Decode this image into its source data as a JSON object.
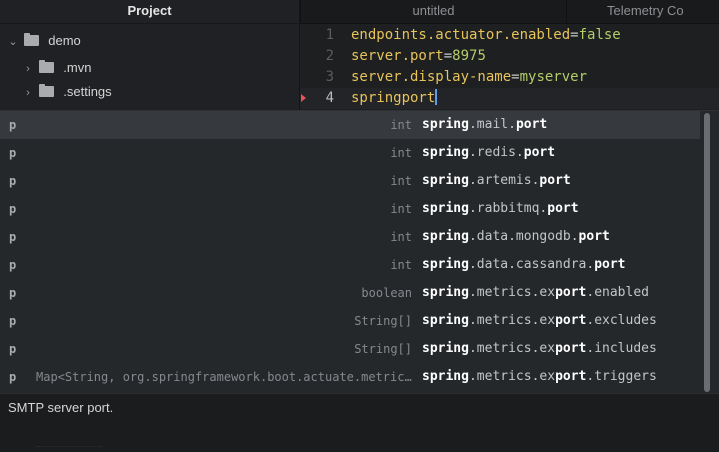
{
  "project": {
    "title": "Project",
    "tree": [
      {
        "label": "demo",
        "expanded": true
      },
      {
        "label": ".mvn",
        "expanded": false
      },
      {
        "label": ".settings",
        "expanded": false
      }
    ]
  },
  "tabs": [
    "untitled",
    "Telemetry Co"
  ],
  "editor": {
    "lines": [
      {
        "num": "1",
        "key": "endpoints.actuator.enabled",
        "eq": "=",
        "value": "false"
      },
      {
        "num": "2",
        "key": "server.port",
        "eq": "=",
        "value": "8975"
      },
      {
        "num": "3",
        "key": "server.display-name",
        "eq": "=",
        "value": "myserver"
      },
      {
        "num": "4",
        "key": "springport",
        "eq": "",
        "value": ""
      }
    ]
  },
  "autocomplete": {
    "items": [
      {
        "kind": "p",
        "type": "int",
        "pre": "",
        "m1": "spring",
        "mid": ".mail.",
        "m2": "port",
        "post": ""
      },
      {
        "kind": "p",
        "type": "int",
        "pre": "",
        "m1": "spring",
        "mid": ".redis.",
        "m2": "port",
        "post": ""
      },
      {
        "kind": "p",
        "type": "int",
        "pre": "",
        "m1": "spring",
        "mid": ".artemis.",
        "m2": "port",
        "post": ""
      },
      {
        "kind": "p",
        "type": "int",
        "pre": "",
        "m1": "spring",
        "mid": ".rabbitmq.",
        "m2": "port",
        "post": ""
      },
      {
        "kind": "p",
        "type": "int",
        "pre": "",
        "m1": "spring",
        "mid": ".data.mongodb.",
        "m2": "port",
        "post": ""
      },
      {
        "kind": "p",
        "type": "int",
        "pre": "",
        "m1": "spring",
        "mid": ".data.cassandra.",
        "m2": "port",
        "post": ""
      },
      {
        "kind": "p",
        "type": "boolean",
        "pre": "",
        "m1": "spring",
        "mid": ".metrics.ex",
        "m2": "port",
        "post": ".enabled"
      },
      {
        "kind": "p",
        "type": "String[]",
        "pre": "",
        "m1": "spring",
        "mid": ".metrics.ex",
        "m2": "port",
        "post": ".excludes"
      },
      {
        "kind": "p",
        "type": "String[]",
        "pre": "",
        "m1": "spring",
        "mid": ".metrics.ex",
        "m2": "port",
        "post": ".includes"
      },
      {
        "kind": "p",
        "type": "Map<String, org.springframework.boot.actuate.metrics.export.TriggerProperties>",
        "pre": "",
        "m1": "spring",
        "mid": ".metrics.ex",
        "m2": "port",
        "post": ".triggers"
      }
    ],
    "description": "SMTP server port."
  },
  "colors": {
    "key": "#e7c35a",
    "value": "#b5cd68",
    "cursor": "#5f9bea",
    "marker": "#e55454"
  }
}
